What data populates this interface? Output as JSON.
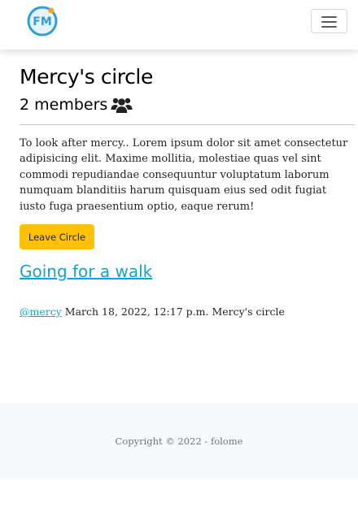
{
  "navbar": {
    "logo_text": "FM",
    "toggler_icon": "hamburger-icon"
  },
  "circle": {
    "title": "Mercy's circle",
    "members_label": "2 members",
    "members_icon": "users-icon",
    "description": "To look after mercy.. Lorem ipsum dolor sit amet consectetur adipisicing elit. Maxime mollitia, molestiae quas vel sint commodi repudiandae consequuntur voluptatum laborum numquam blanditiis harum quisquam eius sed odit fugiat iusto fuga praesentium optio, eaque rerum!",
    "leave_label": "Leave Circle"
  },
  "post": {
    "title": "Going for a walk",
    "author": "@mercy",
    "date": "March 18, 2022, 12:17 p.m.",
    "circle_name": "Mercy's circle"
  },
  "footer": {
    "copyright": "Copyright © 2022 - folome"
  },
  "colors": {
    "accent": "#17a2c8",
    "button": "#ffc107",
    "footer_bg": "#f8f9fa"
  }
}
